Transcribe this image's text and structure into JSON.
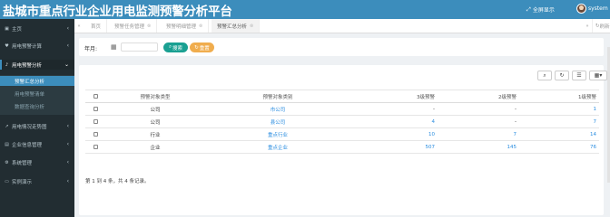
{
  "header": {
    "title": "盐城市重点行业企业用电监测预警分析平台",
    "fullscreen_label": "全屏显示",
    "username": "system"
  },
  "sidebar": {
    "items": [
      {
        "icon": "home-icon",
        "label": "主页"
      },
      {
        "icon": "heart-icon",
        "label": "用电预警计算"
      },
      {
        "icon": "bell-icon",
        "label": "用电预警分析"
      },
      {
        "icon": "chart-line-icon",
        "label": "用电情况走势图"
      },
      {
        "icon": "id-card-icon",
        "label": "企业信息管理"
      },
      {
        "icon": "gear-icon",
        "label": "系统管理"
      },
      {
        "icon": "monitor-icon",
        "label": "实例演示"
      }
    ],
    "submenu": [
      {
        "label": "预警汇总分析"
      },
      {
        "label": "用电预警清单"
      },
      {
        "label": "数据查询分析"
      }
    ]
  },
  "tabs": {
    "items": [
      {
        "label": "首页"
      },
      {
        "label": "预警任务管理"
      },
      {
        "label": "预警明细管理"
      },
      {
        "label": "预警汇总分析"
      }
    ],
    "refresh_label": "刷新"
  },
  "search": {
    "year_label": "年月:",
    "year_value": "",
    "search_button": "搜索",
    "reset_button": "重置"
  },
  "table": {
    "headers": [
      "预警对象类型",
      "预警对象类别",
      "3级预警",
      "2级预警",
      "1级预警"
    ],
    "rows": [
      {
        "type": "公司",
        "category": "市公司",
        "l3": "-",
        "l2": "-",
        "l1": "1"
      },
      {
        "type": "公司",
        "category": "县公司",
        "l3": "4",
        "l2": "-",
        "l1": "7"
      },
      {
        "type": "行业",
        "category": "重点行业",
        "l3": "10",
        "l2": "7",
        "l1": "14"
      },
      {
        "type": "企业",
        "category": "重点企业",
        "l3": "507",
        "l2": "145",
        "l1": "76"
      }
    ],
    "footer": "第 1 到 4 条，共 4 条记录。"
  },
  "colors": {
    "header_bg": "#3c8dbc",
    "sidebar_bg": "#222d32",
    "search_btn": "#1aa092",
    "reset_btn": "#f0ad4e",
    "link": "#2a8de0"
  }
}
